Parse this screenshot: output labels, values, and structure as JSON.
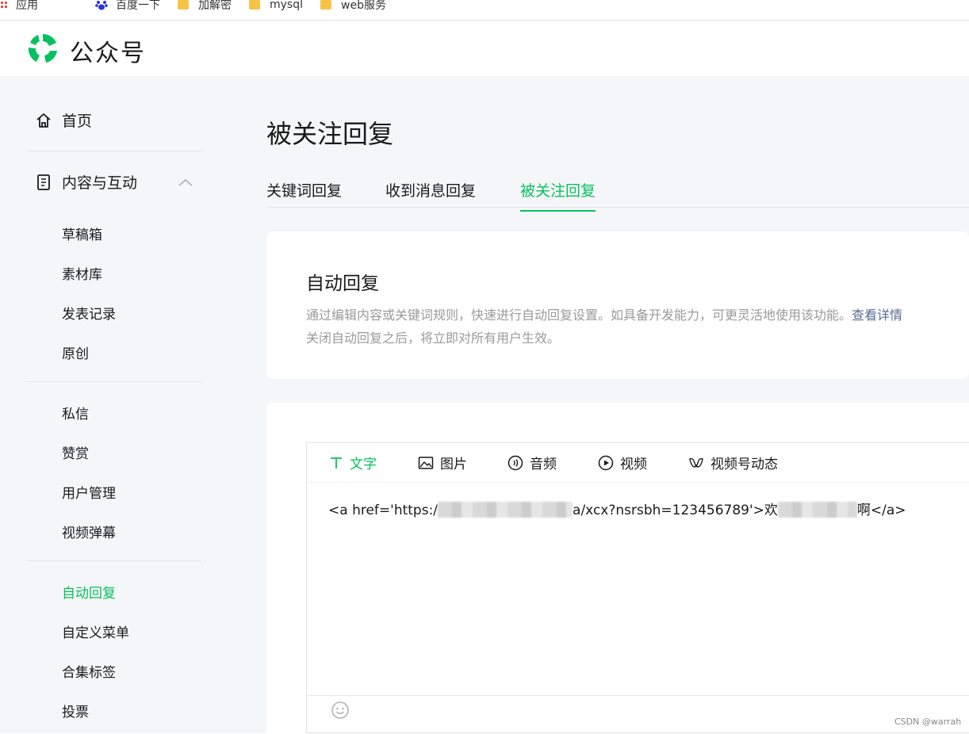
{
  "bookmarks": [
    {
      "label": "应用",
      "icon": "apps-icon"
    },
    {
      "label": "百度一下",
      "icon": "baidu-icon"
    },
    {
      "label": "加解密",
      "icon": "folder-icon"
    },
    {
      "label": "mysql",
      "icon": "folder-icon"
    },
    {
      "label": "web服务",
      "icon": "folder-icon"
    }
  ],
  "header": {
    "brand": "公众号"
  },
  "sidebar": {
    "home": "首页",
    "content_group": "内容与互动",
    "group1": [
      "草稿箱",
      "素材库",
      "发表记录",
      "原创"
    ],
    "group2": [
      "私信",
      "赞赏",
      "用户管理",
      "视频弹幕"
    ],
    "group3": [
      "自动回复",
      "自定义菜单",
      "合集标签",
      "投票"
    ],
    "active_item": "自动回复"
  },
  "main": {
    "title": "被关注回复",
    "tabs": [
      "关键词回复",
      "收到消息回复",
      "被关注回复"
    ],
    "active_tab": "被关注回复"
  },
  "info_card": {
    "title": "自动回复",
    "desc_line1": "通过编辑内容或关键词规则，快速进行自动回复设置。如具备开发能力，可更灵活地使用该功能。",
    "desc_link": "查看详情",
    "desc_line2": "关闭自动回复之后，将立即对所有用户生效。"
  },
  "editor": {
    "tools": [
      {
        "label": "文字",
        "icon": "text-icon"
      },
      {
        "label": "图片",
        "icon": "image-icon"
      },
      {
        "label": "音频",
        "icon": "audio-icon"
      },
      {
        "label": "视频",
        "icon": "video-icon"
      },
      {
        "label": "视频号动态",
        "icon": "channels-icon"
      }
    ],
    "active_tool": "文字",
    "content_part1": "<a href='https:/",
    "content_part2": "a/xcx?nsrsbh=123456789'>欢",
    "content_part3": "啊</a>"
  },
  "watermark": "CSDN @warrah",
  "colors": {
    "accent": "#07c160",
    "link": "#576b95",
    "muted": "#9a9a9a",
    "bg": "#f5f6f7"
  }
}
